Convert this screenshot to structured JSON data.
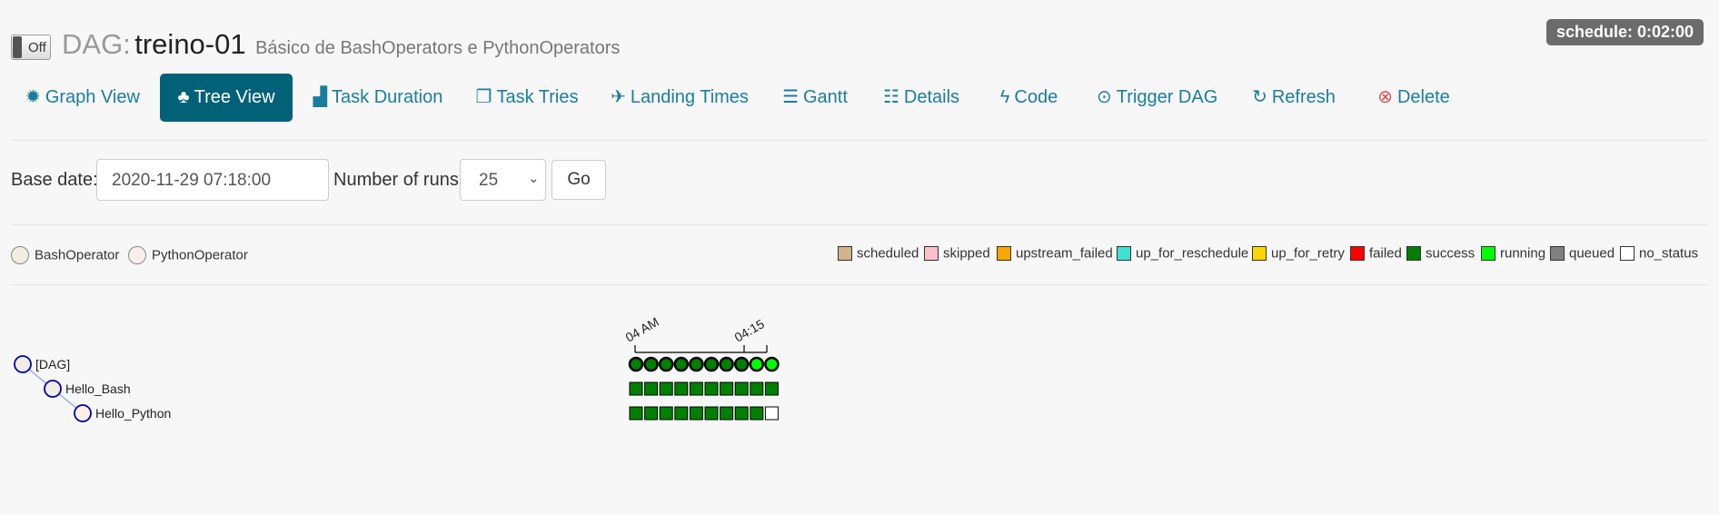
{
  "header": {
    "toggle_label": "Off",
    "dag_prefix": "DAG:",
    "dag_id": "treino-01",
    "description": "Básico de BashOperators e PythonOperators",
    "schedule": "schedule: 0:02:00"
  },
  "tabs": [
    {
      "label": "Graph View",
      "icon": "sun-icon"
    },
    {
      "label": "Tree View",
      "icon": "tree-icon",
      "active": true
    },
    {
      "label": "Task Duration",
      "icon": "bar-chart-icon"
    },
    {
      "label": "Task Tries",
      "icon": "duplicate-icon"
    },
    {
      "label": "Landing Times",
      "icon": "plane-icon"
    },
    {
      "label": "Gantt",
      "icon": "align-left-icon"
    },
    {
      "label": "Details",
      "icon": "list-icon"
    },
    {
      "label": "Code",
      "icon": "bolt-icon"
    },
    {
      "label": "Trigger DAG",
      "icon": "play-circle-icon"
    },
    {
      "label": "Refresh",
      "icon": "refresh-icon"
    },
    {
      "label": "Delete",
      "icon": "remove-circle-icon"
    }
  ],
  "form": {
    "base_date_label": "Base date:",
    "base_date_value": "2020-11-29 07:18:00",
    "num_runs_label": "Number of runs:",
    "num_runs_value": "25",
    "go_label": "Go"
  },
  "operators": [
    {
      "name": "BashOperator",
      "color": "#f0ede4"
    },
    {
      "name": "PythonOperator",
      "color": "#ffefeb"
    }
  ],
  "legend": [
    {
      "state": "scheduled",
      "color": "#d2b48c"
    },
    {
      "state": "skipped",
      "color": "#ffc0cb"
    },
    {
      "state": "upstream_failed",
      "color": "#ffa500"
    },
    {
      "state": "up_for_reschedule",
      "color": "#40e0d0"
    },
    {
      "state": "up_for_retry",
      "color": "#ffd700"
    },
    {
      "state": "failed",
      "color": "#ff0000"
    },
    {
      "state": "success",
      "color": "#008000"
    },
    {
      "state": "running",
      "color": "#00ff00"
    },
    {
      "state": "queued",
      "color": "#808080"
    },
    {
      "state": "no_status",
      "color": "#ffffff"
    }
  ],
  "tree": {
    "nodes": [
      "[DAG]",
      "Hello_Bash",
      "Hello_Python"
    ],
    "time_ticks": [
      "04 AM",
      "04:15"
    ],
    "dag_runs": [
      "success",
      "success",
      "success",
      "success",
      "success",
      "success",
      "success",
      "success",
      "running",
      "running"
    ],
    "task_instances": [
      [
        "success",
        "success",
        "success",
        "success",
        "success",
        "success",
        "success",
        "success",
        "success",
        "success"
      ],
      [
        "success",
        "success",
        "success",
        "success",
        "success",
        "success",
        "success",
        "success",
        "success",
        "no_status"
      ]
    ]
  }
}
